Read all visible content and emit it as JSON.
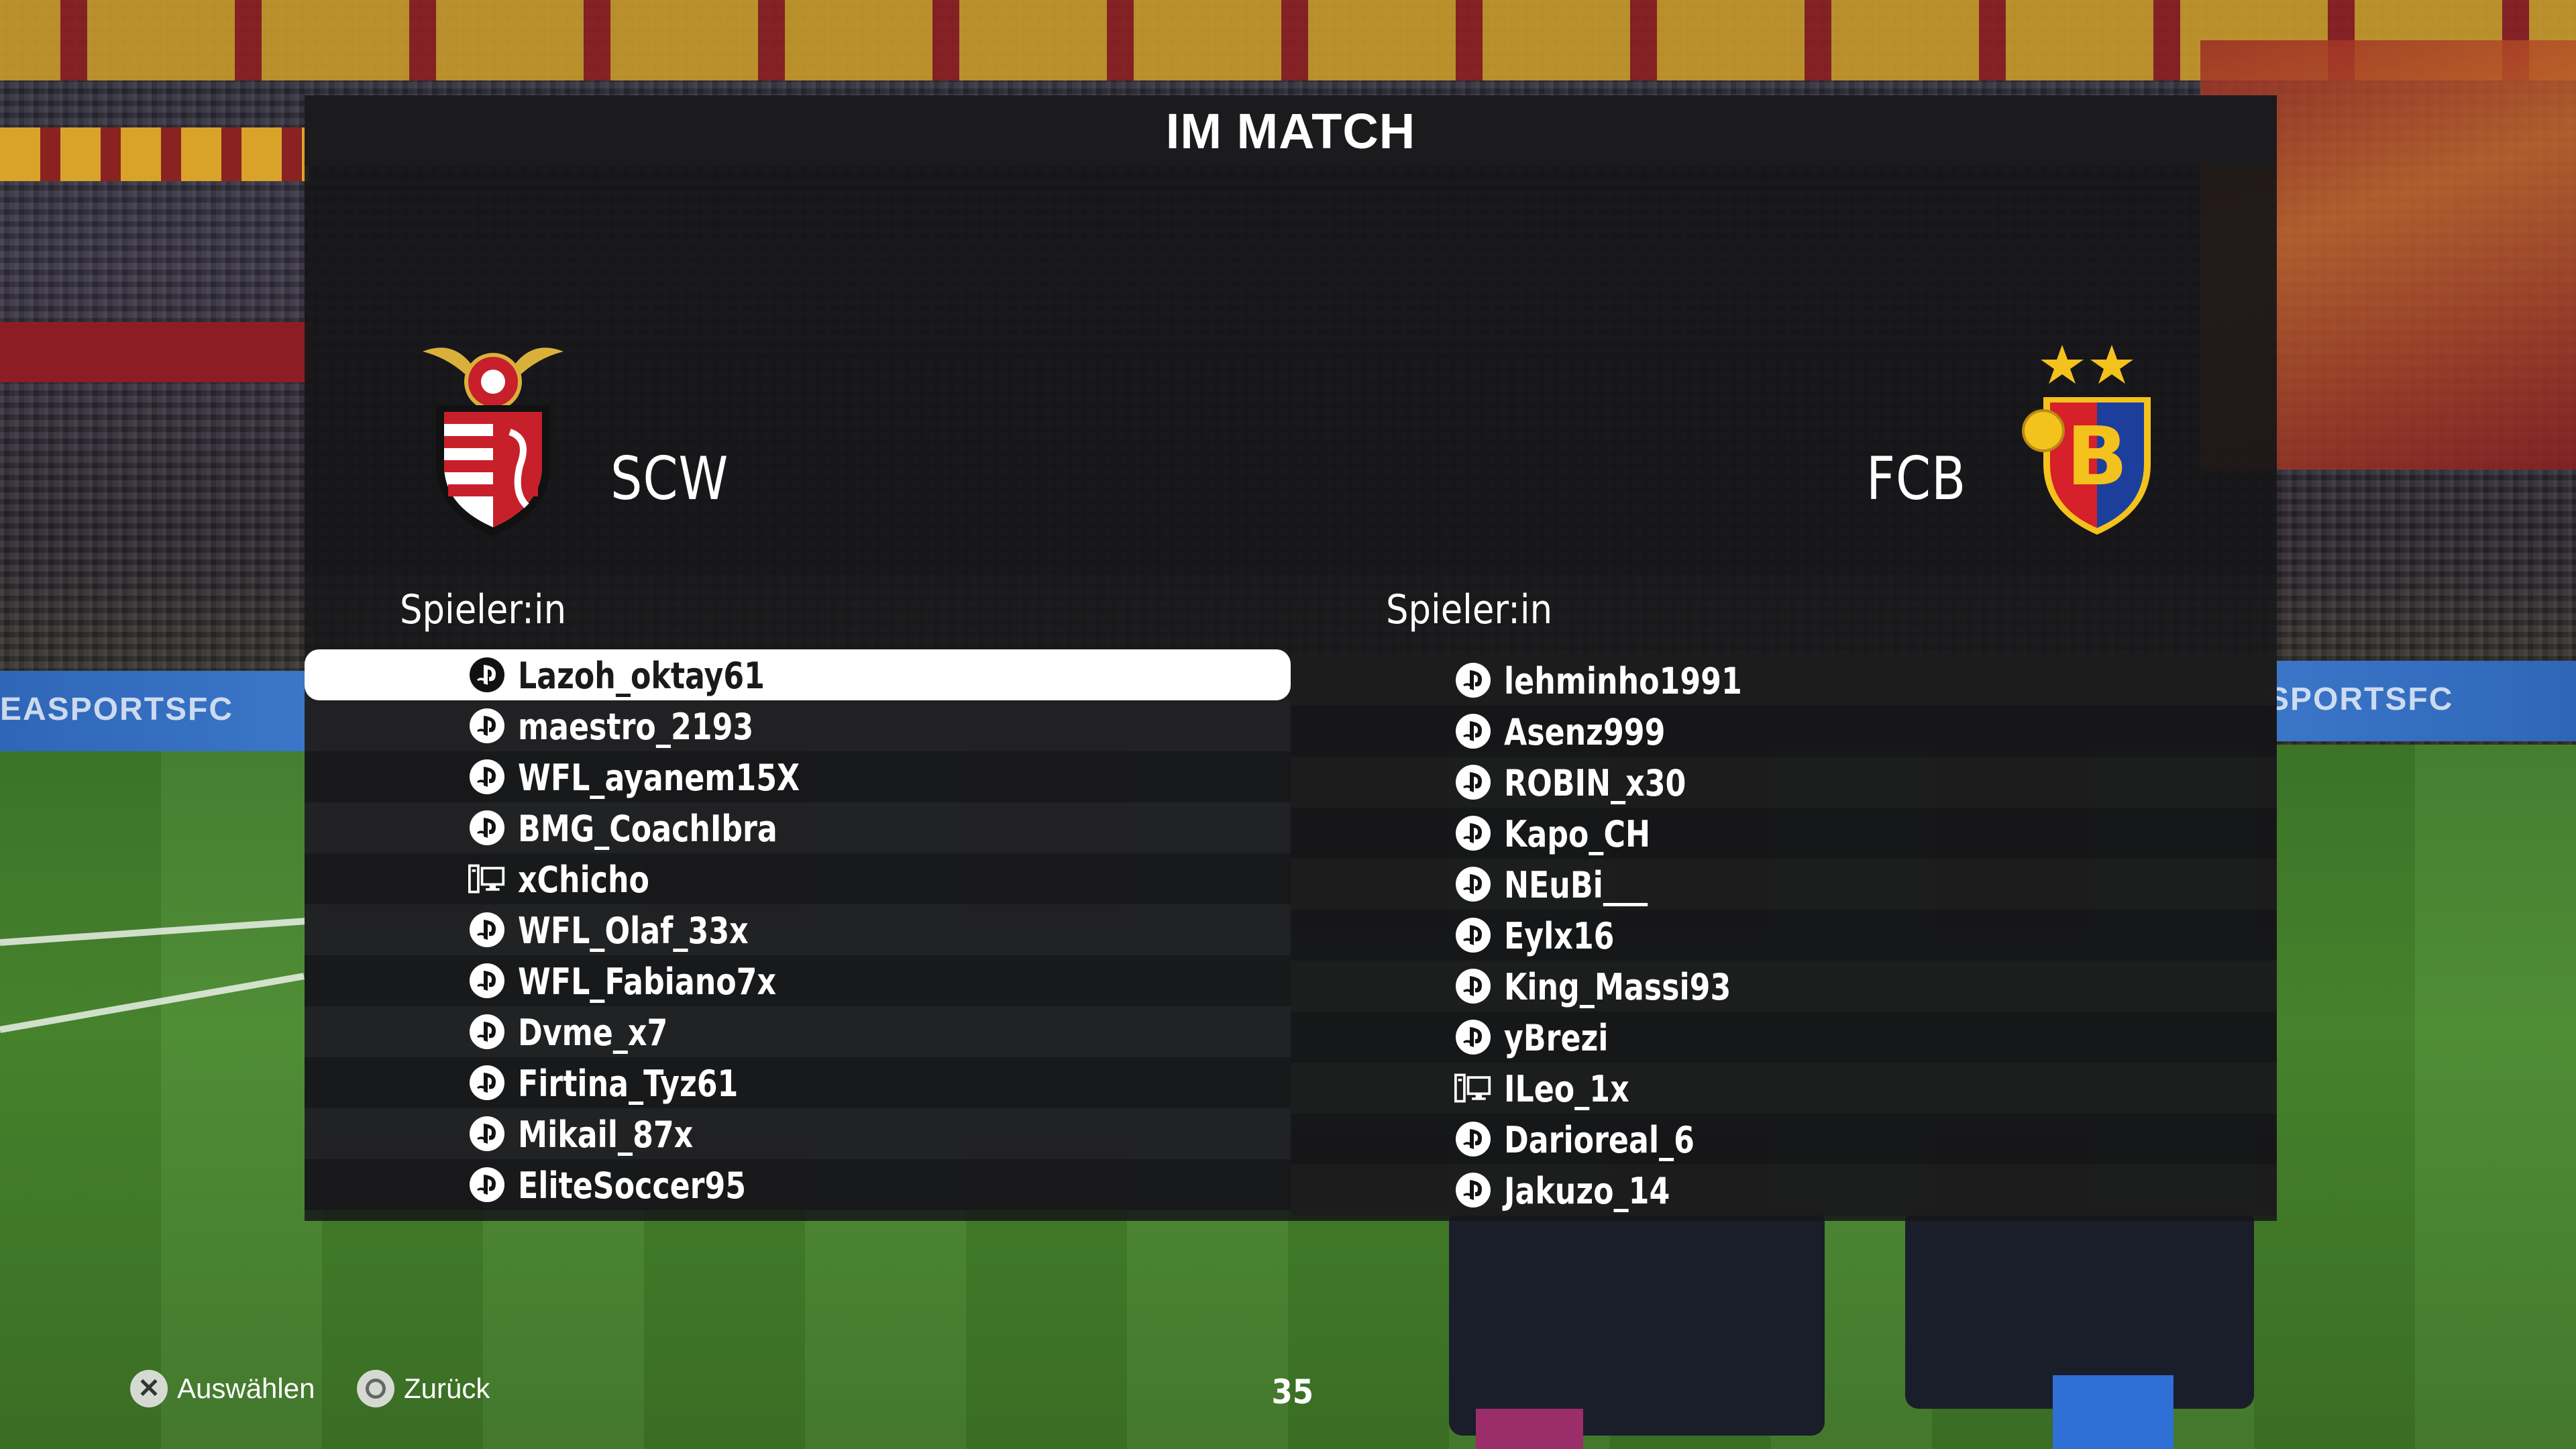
{
  "screen": {
    "title": "IM MATCH"
  },
  "home": {
    "short_name": "SCW",
    "column_header": "Spieler:in",
    "players": [
      {
        "name": "Lazoh_oktay61",
        "platform": "playstation-icon",
        "selected": true
      },
      {
        "name": "maestro_2193",
        "platform": "playstation-icon"
      },
      {
        "name": "WFL_ayanem15X",
        "platform": "playstation-icon"
      },
      {
        "name": "BMG_CoachIbra",
        "platform": "playstation-icon"
      },
      {
        "name": "xChicho",
        "platform": "pc-icon"
      },
      {
        "name": "WFL_Olaf_33x",
        "platform": "playstation-icon"
      },
      {
        "name": "WFL_Fabiano7x",
        "platform": "playstation-icon"
      },
      {
        "name": "Dvme_x7",
        "platform": "playstation-icon"
      },
      {
        "name": "Firtina_Tyz61",
        "platform": "playstation-icon"
      },
      {
        "name": "Mikail_87x",
        "platform": "playstation-icon"
      },
      {
        "name": "EliteSoccer95",
        "platform": "playstation-icon"
      }
    ]
  },
  "away": {
    "short_name": "FCB",
    "column_header": "Spieler:in",
    "players": [
      {
        "name": "lehminho1991",
        "platform": "playstation-icon"
      },
      {
        "name": "Asenz999",
        "platform": "playstation-icon"
      },
      {
        "name": "ROBIN_x30",
        "platform": "playstation-icon"
      },
      {
        "name": "Kapo_CH",
        "platform": "playstation-icon"
      },
      {
        "name": "NEuBi___",
        "platform": "playstation-icon"
      },
      {
        "name": "Eylx16",
        "platform": "playstation-icon"
      },
      {
        "name": "King_Massi93",
        "platform": "playstation-icon"
      },
      {
        "name": "yBrezi",
        "platform": "playstation-icon"
      },
      {
        "name": "ILeo_1x",
        "platform": "pc-icon"
      },
      {
        "name": "Darioreal_6",
        "platform": "playstation-icon"
      },
      {
        "name": "Jakuzo_14",
        "platform": "playstation-icon"
      }
    ]
  },
  "footer": {
    "select_label": "Auswählen",
    "back_label": "Zurück",
    "timer": "35"
  },
  "background": {
    "board_text": "EASPORTSFC",
    "board_text_right": "SPORTSFC"
  },
  "colors": {
    "selected_row": "#ffffff",
    "panel": "#161618",
    "home_logo_red": "#c8202a",
    "away_logo_red": "#d6202a",
    "away_logo_blue": "#1d3f9c",
    "star": "#f4c21c"
  }
}
